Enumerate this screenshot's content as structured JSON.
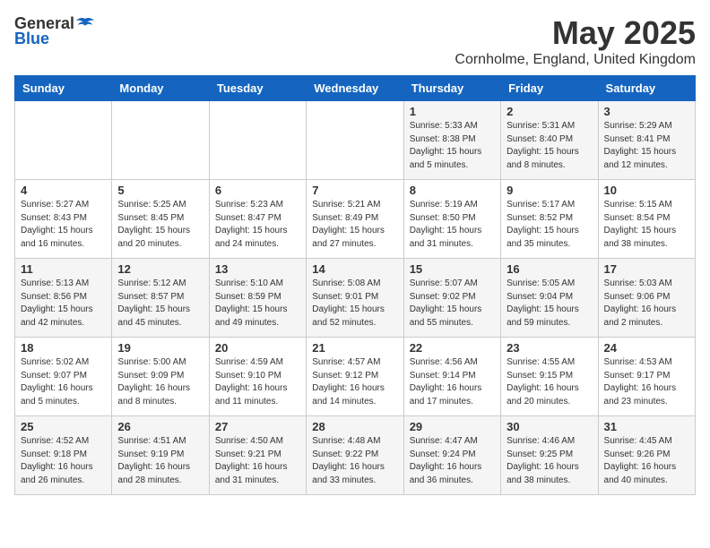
{
  "header": {
    "logo_general": "General",
    "logo_blue": "Blue",
    "title": "May 2025",
    "subtitle": "Cornholme, England, United Kingdom"
  },
  "days_of_week": [
    "Sunday",
    "Monday",
    "Tuesday",
    "Wednesday",
    "Thursday",
    "Friday",
    "Saturday"
  ],
  "weeks": [
    [
      {
        "day": "",
        "content": ""
      },
      {
        "day": "",
        "content": ""
      },
      {
        "day": "",
        "content": ""
      },
      {
        "day": "",
        "content": ""
      },
      {
        "day": "1",
        "content": "Sunrise: 5:33 AM\nSunset: 8:38 PM\nDaylight: 15 hours\nand 5 minutes."
      },
      {
        "day": "2",
        "content": "Sunrise: 5:31 AM\nSunset: 8:40 PM\nDaylight: 15 hours\nand 8 minutes."
      },
      {
        "day": "3",
        "content": "Sunrise: 5:29 AM\nSunset: 8:41 PM\nDaylight: 15 hours\nand 12 minutes."
      }
    ],
    [
      {
        "day": "4",
        "content": "Sunrise: 5:27 AM\nSunset: 8:43 PM\nDaylight: 15 hours\nand 16 minutes."
      },
      {
        "day": "5",
        "content": "Sunrise: 5:25 AM\nSunset: 8:45 PM\nDaylight: 15 hours\nand 20 minutes."
      },
      {
        "day": "6",
        "content": "Sunrise: 5:23 AM\nSunset: 8:47 PM\nDaylight: 15 hours\nand 24 minutes."
      },
      {
        "day": "7",
        "content": "Sunrise: 5:21 AM\nSunset: 8:49 PM\nDaylight: 15 hours\nand 27 minutes."
      },
      {
        "day": "8",
        "content": "Sunrise: 5:19 AM\nSunset: 8:50 PM\nDaylight: 15 hours\nand 31 minutes."
      },
      {
        "day": "9",
        "content": "Sunrise: 5:17 AM\nSunset: 8:52 PM\nDaylight: 15 hours\nand 35 minutes."
      },
      {
        "day": "10",
        "content": "Sunrise: 5:15 AM\nSunset: 8:54 PM\nDaylight: 15 hours\nand 38 minutes."
      }
    ],
    [
      {
        "day": "11",
        "content": "Sunrise: 5:13 AM\nSunset: 8:56 PM\nDaylight: 15 hours\nand 42 minutes."
      },
      {
        "day": "12",
        "content": "Sunrise: 5:12 AM\nSunset: 8:57 PM\nDaylight: 15 hours\nand 45 minutes."
      },
      {
        "day": "13",
        "content": "Sunrise: 5:10 AM\nSunset: 8:59 PM\nDaylight: 15 hours\nand 49 minutes."
      },
      {
        "day": "14",
        "content": "Sunrise: 5:08 AM\nSunset: 9:01 PM\nDaylight: 15 hours\nand 52 minutes."
      },
      {
        "day": "15",
        "content": "Sunrise: 5:07 AM\nSunset: 9:02 PM\nDaylight: 15 hours\nand 55 minutes."
      },
      {
        "day": "16",
        "content": "Sunrise: 5:05 AM\nSunset: 9:04 PM\nDaylight: 15 hours\nand 59 minutes."
      },
      {
        "day": "17",
        "content": "Sunrise: 5:03 AM\nSunset: 9:06 PM\nDaylight: 16 hours\nand 2 minutes."
      }
    ],
    [
      {
        "day": "18",
        "content": "Sunrise: 5:02 AM\nSunset: 9:07 PM\nDaylight: 16 hours\nand 5 minutes."
      },
      {
        "day": "19",
        "content": "Sunrise: 5:00 AM\nSunset: 9:09 PM\nDaylight: 16 hours\nand 8 minutes."
      },
      {
        "day": "20",
        "content": "Sunrise: 4:59 AM\nSunset: 9:10 PM\nDaylight: 16 hours\nand 11 minutes."
      },
      {
        "day": "21",
        "content": "Sunrise: 4:57 AM\nSunset: 9:12 PM\nDaylight: 16 hours\nand 14 minutes."
      },
      {
        "day": "22",
        "content": "Sunrise: 4:56 AM\nSunset: 9:14 PM\nDaylight: 16 hours\nand 17 minutes."
      },
      {
        "day": "23",
        "content": "Sunrise: 4:55 AM\nSunset: 9:15 PM\nDaylight: 16 hours\nand 20 minutes."
      },
      {
        "day": "24",
        "content": "Sunrise: 4:53 AM\nSunset: 9:17 PM\nDaylight: 16 hours\nand 23 minutes."
      }
    ],
    [
      {
        "day": "25",
        "content": "Sunrise: 4:52 AM\nSunset: 9:18 PM\nDaylight: 16 hours\nand 26 minutes."
      },
      {
        "day": "26",
        "content": "Sunrise: 4:51 AM\nSunset: 9:19 PM\nDaylight: 16 hours\nand 28 minutes."
      },
      {
        "day": "27",
        "content": "Sunrise: 4:50 AM\nSunset: 9:21 PM\nDaylight: 16 hours\nand 31 minutes."
      },
      {
        "day": "28",
        "content": "Sunrise: 4:48 AM\nSunset: 9:22 PM\nDaylight: 16 hours\nand 33 minutes."
      },
      {
        "day": "29",
        "content": "Sunrise: 4:47 AM\nSunset: 9:24 PM\nDaylight: 16 hours\nand 36 minutes."
      },
      {
        "day": "30",
        "content": "Sunrise: 4:46 AM\nSunset: 9:25 PM\nDaylight: 16 hours\nand 38 minutes."
      },
      {
        "day": "31",
        "content": "Sunrise: 4:45 AM\nSunset: 9:26 PM\nDaylight: 16 hours\nand 40 minutes."
      }
    ]
  ]
}
